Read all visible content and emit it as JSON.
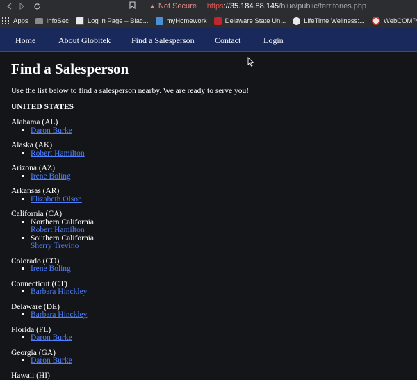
{
  "browser": {
    "not_secure": "Not Secure",
    "url_scheme": "https",
    "url_host": "://35.184.88.145",
    "url_path": "/blue/public/territories.php",
    "bookmarks": [
      {
        "label": "Apps",
        "icon": "apps-grid-icon"
      },
      {
        "label": "InfoSec",
        "icon": "folder-icon"
      },
      {
        "label": "Log in Page – Blac...",
        "icon": "blackboard-icon"
      },
      {
        "label": "myHomework",
        "icon": "myhomework-icon"
      },
      {
        "label": "Delaware State Un...",
        "icon": "dsu-icon"
      },
      {
        "label": "LifeTime Wellness:...",
        "icon": "globe-icon"
      },
      {
        "label": "WebCOM™ 2.0",
        "icon": "webcom-icon"
      }
    ]
  },
  "nav": {
    "items": [
      "Home",
      "About Globitek",
      "Find a Salesperson",
      "Contact",
      "Login"
    ]
  },
  "page": {
    "title": "Find a Salesperson",
    "intro": "Use the list below to find a salesperson nearby. We are ready to serve you!",
    "country": "UNITED STATES"
  },
  "states": [
    {
      "name": "Alabama (AL)",
      "people": [
        "Daron Burke"
      ]
    },
    {
      "name": "Alaska (AK)",
      "people": [
        "Robert Hamilton"
      ]
    },
    {
      "name": "Arizona (AZ)",
      "people": [
        "Irene Boling"
      ]
    },
    {
      "name": "Arkansas (AR)",
      "people": [
        "Elizabeth Olson"
      ]
    },
    {
      "name": "California (CA)",
      "regions": [
        {
          "region": "Northern California",
          "people": [
            "Robert Hamilton"
          ]
        },
        {
          "region": "Southern California",
          "people": [
            "Sherry Trevino"
          ]
        }
      ]
    },
    {
      "name": "Colorado (CO)",
      "people": [
        "Irene Boling"
      ]
    },
    {
      "name": "Connecticut (CT)",
      "people": [
        "Barbara Hinckley"
      ]
    },
    {
      "name": "Delaware (DE)",
      "people": [
        "Barbara Hinckley"
      ]
    },
    {
      "name": "Florida (FL)",
      "people": [
        "Daron Burke"
      ]
    },
    {
      "name": "Georgia (GA)",
      "people": [
        "Daron Burke"
      ]
    },
    {
      "name": "Hawaii (HI)",
      "people": []
    }
  ],
  "colors": {
    "nav_bg": "#19295c",
    "page_bg": "#141518",
    "link": "#4d7fff"
  }
}
